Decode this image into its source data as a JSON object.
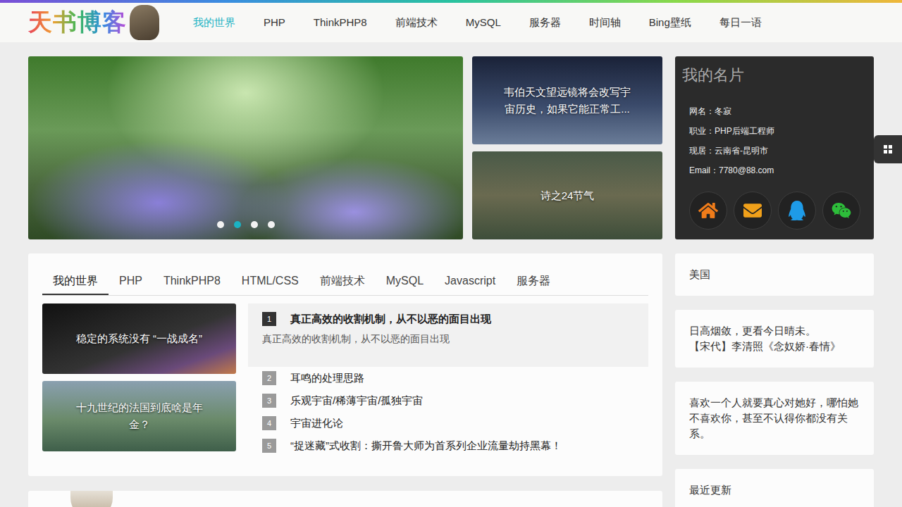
{
  "header": {
    "logo": "天书博客",
    "nav": [
      {
        "label": "我的世界",
        "selected": true
      },
      {
        "label": "PHP",
        "selected": false
      },
      {
        "label": "ThinkPHP8",
        "selected": false
      },
      {
        "label": "前端技术",
        "selected": false
      },
      {
        "label": "MySQL",
        "selected": false
      },
      {
        "label": "服务器",
        "selected": false
      },
      {
        "label": "时间轴",
        "selected": false
      },
      {
        "label": "Bing壁纸",
        "selected": false
      },
      {
        "label": "每日一语",
        "selected": false
      }
    ]
  },
  "slider": {
    "dots": [
      {
        "selected": false
      },
      {
        "selected": true
      },
      {
        "selected": false
      },
      {
        "selected": false
      }
    ]
  },
  "featured": [
    {
      "title": "韦伯天文望远镜将会改写宇宙历史，如果它能正常工..."
    },
    {
      "title": "诗之24节气"
    }
  ],
  "profile": {
    "title": "我的名片",
    "lines": [
      "网名：冬寂",
      "职业：PHP后端工程师",
      "现居：云南省-昆明市",
      "Email：7780@88.com"
    ],
    "links": [
      {
        "kind": "home",
        "color": "#f07c1a"
      },
      {
        "kind": "mail",
        "color": "#f0a01a"
      },
      {
        "kind": "qq",
        "color": "#1e9be8"
      },
      {
        "kind": "wechat",
        "color": "#2dbd3a"
      }
    ]
  },
  "category": {
    "tabs": [
      {
        "label": "我的世界",
        "selected": true
      },
      {
        "label": "PHP",
        "selected": false
      },
      {
        "label": "ThinkPHP8",
        "selected": false
      },
      {
        "label": "HTML/CSS",
        "selected": false
      },
      {
        "label": "前端技术",
        "selected": false
      },
      {
        "label": "MySQL",
        "selected": false
      },
      {
        "label": "Javascript",
        "selected": false
      },
      {
        "label": "服务器",
        "selected": false
      }
    ],
    "cards": [
      {
        "title": "稳定的系统没有 “一战成名”"
      },
      {
        "title": "十九世纪的法国到底啥是年金？"
      }
    ],
    "articles": [
      {
        "number": "1",
        "title": "真正高效的收割机制，从不以恶的面目出现",
        "summary": "真正高效的收割机制，从不以恶的面目出现",
        "expanded": true
      },
      {
        "number": "2",
        "title": "耳鸣的处理思路",
        "summary": "",
        "expanded": false
      },
      {
        "number": "3",
        "title": "乐观宇宙/稀薄宇宙/孤独宇宙",
        "summary": "",
        "expanded": false
      },
      {
        "number": "4",
        "title": "宇宙进化论",
        "summary": "",
        "expanded": false
      },
      {
        "number": "5",
        "title": "“捉迷藏”式收割：撕开鲁大师为首系列企业流量劫持黑幕！",
        "summary": "",
        "expanded": false
      }
    ]
  },
  "sidebar": {
    "cards": [
      {
        "lines": [
          "美国"
        ]
      },
      {
        "lines": [
          "日高烟敛，更看今日晴未。",
          "【宋代】李清照《念奴娇·春情》"
        ]
      },
      {
        "lines": [
          "喜欢一个人就要真心对她好，哪怕她不喜欢你，甚至不认得你都没有关系。"
        ]
      },
      {
        "lines": [
          "最近更新"
        ]
      }
    ]
  }
}
